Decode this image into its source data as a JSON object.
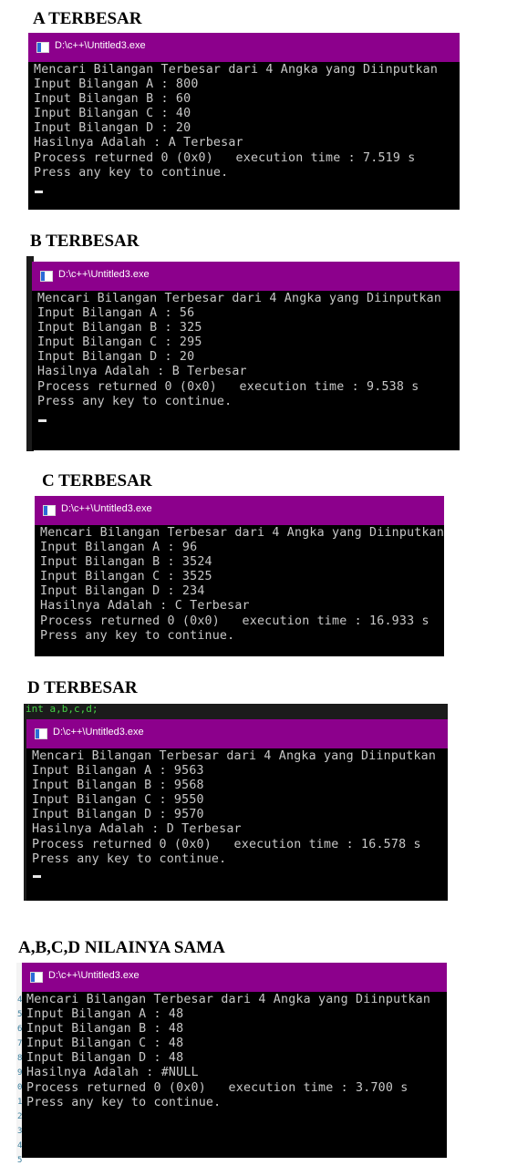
{
  "window_title": "D:\\c++\\Untitled3.exe",
  "sections": [
    {
      "heading": "A TERBESAR",
      "lines": [
        "Mencari Bilangan Terbesar dari 4 Angka yang Diinputkan",
        "Input Bilangan A : 800",
        "Input Bilangan B : 60",
        "Input Bilangan C : 40",
        "Input Bilangan D : 20",
        "Hasilnya Adalah : A Terbesar",
        "Process returned 0 (0x0)   execution time : 7.519 s",
        "Press any key to continue."
      ]
    },
    {
      "heading": "B TERBESAR",
      "lines": [
        "Mencari Bilangan Terbesar dari 4 Angka yang Diinputkan",
        "Input Bilangan A : 56",
        "Input Bilangan B : 325",
        "Input Bilangan C : 295",
        "Input Bilangan D : 20",
        "Hasilnya Adalah : B Terbesar",
        "Process returned 0 (0x0)   execution time : 9.538 s",
        "Press any key to continue."
      ]
    },
    {
      "heading": "C TERBESAR",
      "lines": [
        "Mencari Bilangan Terbesar dari 4 Angka yang Diinputkan",
        "Input Bilangan A : 96",
        "Input Bilangan B : 3524",
        "Input Bilangan C : 3525",
        "Input Bilangan D : 234",
        "Hasilnya Adalah : C Terbesar",
        "Process returned 0 (0x0)   execution time : 16.933 s",
        "Press any key to continue."
      ]
    },
    {
      "heading": "D TERBESAR",
      "code_snippet": "int a,b,c,d;",
      "lines": [
        "Mencari Bilangan Terbesar dari 4 Angka yang Diinputkan",
        "Input Bilangan A : 9563",
        "Input Bilangan B : 9568",
        "Input Bilangan C : 9550",
        "Input Bilangan D : 9570",
        "Hasilnya Adalah : D Terbesar",
        "Process returned 0 (0x0)   execution time : 16.578 s",
        "Press any key to continue."
      ]
    },
    {
      "heading": "A,B,C,D NILAINYA SAMA",
      "gutter_numbers": [
        "4",
        "5",
        "6",
        "7",
        "8",
        "9",
        "0",
        "1",
        "2",
        "3",
        "4",
        "5"
      ],
      "lines": [
        "Mencari Bilangan Terbesar dari 4 Angka yang Diinputkan",
        "Input Bilangan A : 48",
        "Input Bilangan B : 48",
        "Input Bilangan C : 48",
        "Input Bilangan D : 48",
        "Hasilnya Adalah : #NULL",
        "Process returned 0 (0x0)   execution time : 3.700 s",
        "Press any key to continue."
      ]
    }
  ],
  "colors": {
    "titlebar": "#8c008c",
    "console_bg": "#000000",
    "console_text": "#c8c8c8"
  }
}
